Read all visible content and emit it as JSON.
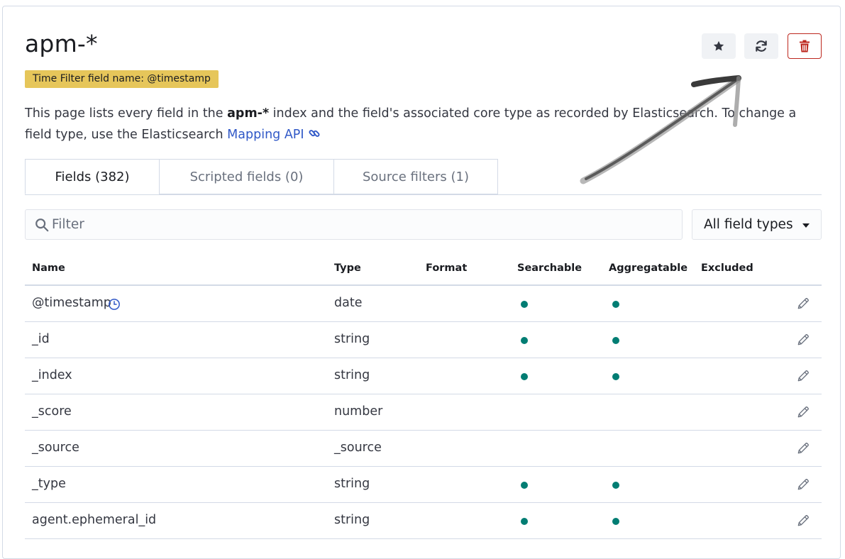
{
  "header": {
    "title": "apm-*",
    "time_filter_badge": "Time Filter field name: @timestamp",
    "buttons": [
      {
        "name": "set-default-index-button",
        "icon": "star-icon"
      },
      {
        "name": "refresh-fields-button",
        "icon": "refresh-icon"
      },
      {
        "name": "delete-index-pattern-button",
        "icon": "trash-icon"
      }
    ]
  },
  "description": {
    "part1": "This page lists every field in the ",
    "index_name": "apm-*",
    "part2": " index and the field's associated core type as recorded by Elasticsearch. To change a field type, use the Elasticsearch ",
    "link_text": "Mapping API"
  },
  "tabs": [
    {
      "label": "Fields (382)",
      "selected": true
    },
    {
      "label": "Scripted fields (0)",
      "selected": false
    },
    {
      "label": "Source filters (1)",
      "selected": false
    }
  ],
  "filter": {
    "placeholder": "Filter",
    "type_select_value": "All field types"
  },
  "table": {
    "columns": [
      "Name",
      "Type",
      "Format",
      "Searchable",
      "Aggregatable",
      "Excluded"
    ],
    "rows": [
      {
        "name": "@timestamp",
        "type": "date",
        "format": "",
        "searchable": true,
        "aggregatable": true,
        "excluded": false,
        "time_field": true
      },
      {
        "name": "_id",
        "type": "string",
        "format": "",
        "searchable": true,
        "aggregatable": true,
        "excluded": false
      },
      {
        "name": "_index",
        "type": "string",
        "format": "",
        "searchable": true,
        "aggregatable": true,
        "excluded": false
      },
      {
        "name": "_score",
        "type": "number",
        "format": "",
        "searchable": false,
        "aggregatable": false,
        "excluded": false
      },
      {
        "name": "_source",
        "type": "_source",
        "format": "",
        "searchable": false,
        "aggregatable": false,
        "excluded": false
      },
      {
        "name": "_type",
        "type": "string",
        "format": "",
        "searchable": true,
        "aggregatable": true,
        "excluded": false
      },
      {
        "name": "agent.ephemeral_id",
        "type": "string",
        "format": "",
        "searchable": true,
        "aggregatable": true,
        "excluded": false
      }
    ]
  },
  "colors": {
    "accent": "#3058c7",
    "badge": "#e6c65a",
    "danger": "#bd271e",
    "dot": "#017d73"
  }
}
